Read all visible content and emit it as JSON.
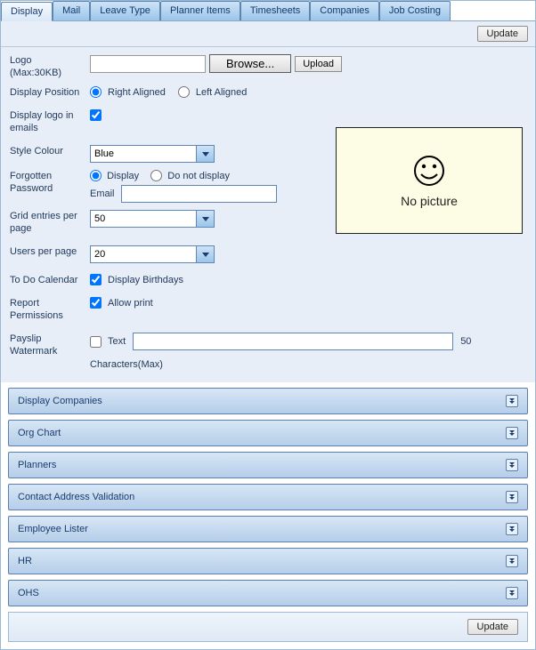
{
  "tabs": [
    {
      "label": "Display"
    },
    {
      "label": "Mail"
    },
    {
      "label": "Leave Type"
    },
    {
      "label": "Planner Items"
    },
    {
      "label": "Timesheets"
    },
    {
      "label": "Companies"
    },
    {
      "label": "Job Costing"
    }
  ],
  "update_label": "Update",
  "logo": {
    "label": "Logo (Max:30KB)",
    "browse": "Browse...",
    "upload": "Upload"
  },
  "display_position": {
    "label": "Display Position",
    "right": "Right Aligned",
    "left": "Left Aligned"
  },
  "display_logo_emails": {
    "label": "Display logo in emails"
  },
  "style_colour": {
    "label": "Style Colour",
    "value": "Blue"
  },
  "forgotten_pw": {
    "label": "Forgotten Password",
    "opt_display": "Display",
    "opt_no_display": "Do not display",
    "email_label": "Email"
  },
  "grid_entries": {
    "label": "Grid entries per page",
    "value": "50"
  },
  "users_pp": {
    "label": "Users per page",
    "value": "20"
  },
  "todo_cal": {
    "label": "To Do Calendar",
    "chk": "Display Birthdays"
  },
  "report_perm": {
    "label": "Report Permissions",
    "chk": "Allow print"
  },
  "payslip_wm": {
    "label": "Payslip Watermark",
    "text_label": "Text",
    "suffix": "50",
    "chars_max": "Characters(Max)"
  },
  "preview_caption": "No picture",
  "accordion": [
    {
      "label": "Display Companies"
    },
    {
      "label": "Org Chart"
    },
    {
      "label": "Planners"
    },
    {
      "label": "Contact Address Validation"
    },
    {
      "label": "Employee Lister"
    },
    {
      "label": "HR"
    },
    {
      "label": "OHS"
    }
  ]
}
